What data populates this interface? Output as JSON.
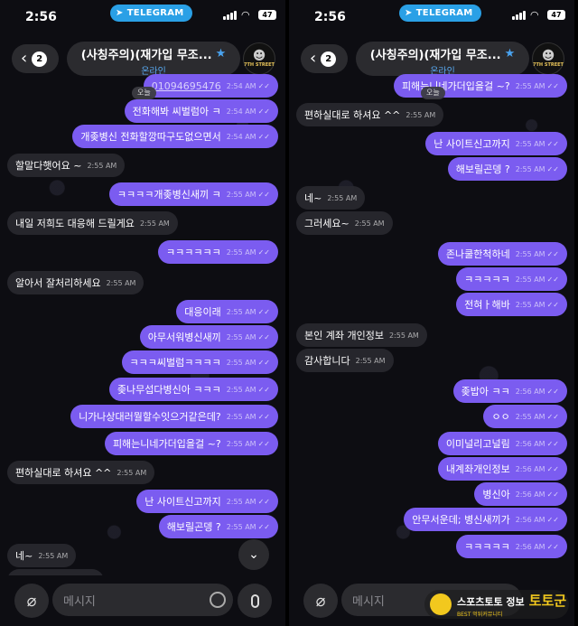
{
  "status": {
    "time": "2:56",
    "app_pill": "TELEGRAM",
    "battery": "47"
  },
  "header": {
    "back_badge": "2",
    "title": "(사칭주의)(재가입 무조...",
    "subtitle": "온라인",
    "avatar_text": "7TH STREET"
  },
  "left_screen": {
    "day_label": "오늘",
    "messages": [
      {
        "text": "01094695476",
        "time": "2:54 AM",
        "out": true,
        "link": true
      },
      {
        "text": "전화해봐 씨벌럼아 ㅋ",
        "time": "2:54 AM",
        "out": true
      },
      {
        "text": "개좆병신 전화할깡따구도없으면서",
        "time": "2:54 AM",
        "out": true
      },
      {
        "text": "할말다햇어요 ~",
        "time": "2:55 AM",
        "out": false
      },
      {
        "text": "ㅋㅋㅋㅋ개좆병신새끼 ㅋ",
        "time": "2:55 AM",
        "out": true
      },
      {
        "text": "내일 저희도 대응해 드릴게요",
        "time": "2:55 AM",
        "out": false
      },
      {
        "text": "ㅋㅋㅋㅋㅋㅋ",
        "time": "2:55 AM",
        "out": true
      },
      {
        "text": "알아서 잘처리하세요",
        "time": "2:55 AM",
        "out": false
      },
      {
        "text": "대응이래",
        "time": "2:55 AM",
        "out": true
      },
      {
        "text": "아무서워병신새끼",
        "time": "2:55 AM",
        "out": true
      },
      {
        "text": "ㅋㅋㅋ씨벌럼ㅋㅋㅋㅋ",
        "time": "2:55 AM",
        "out": true
      },
      {
        "text": "좆나무섭다병신아 ㅋㅋㅋ",
        "time": "2:55 AM",
        "out": true
      },
      {
        "text": "니가나상대러뭘할수잇으거같은데?",
        "time": "2:55 AM",
        "out": true
      },
      {
        "text": "피해는니네가더입을걸 ~?",
        "time": "2:55 AM",
        "out": true
      },
      {
        "text": "편하실대로 하셔요 ^^",
        "time": "2:55 AM",
        "out": false
      },
      {
        "text": "난 사이트신고까지",
        "time": "2:55 AM",
        "out": true
      },
      {
        "text": "해보릴곤뎅 ?",
        "time": "2:55 AM",
        "out": true
      },
      {
        "text": "네~",
        "time": "2:55 AM",
        "out": false
      },
      {
        "text": "그러세요~",
        "time": "2:55 AM",
        "out": false
      }
    ]
  },
  "right_screen": {
    "day_label": "오늘",
    "messages": [
      {
        "text": "피해는니네가더입을걸 ~?",
        "time": "2:55 AM",
        "out": true
      },
      {
        "text": "편하실대로 하셔요 ^^",
        "time": "2:55 AM",
        "out": false
      },
      {
        "text": "난 사이트신고까지",
        "time": "2:55 AM",
        "out": true
      },
      {
        "text": "해보릴곤뎅 ?",
        "time": "2:55 AM",
        "out": true
      },
      {
        "text": "네~",
        "time": "2:55 AM",
        "out": false
      },
      {
        "text": "그러세요~",
        "time": "2:55 AM",
        "out": false
      },
      {
        "text": "존나쿨한척하네",
        "time": "2:55 AM",
        "out": true
      },
      {
        "text": "ㅋㅋㅋㅋㅋ",
        "time": "2:55 AM",
        "out": true
      },
      {
        "text": "전혀ㅏ해바",
        "time": "2:55 AM",
        "out": true
      },
      {
        "text": "본인 계좌 개인정보",
        "time": "2:55 AM",
        "out": false
      },
      {
        "text": "감사합니다",
        "time": "2:55 AM",
        "out": false
      },
      {
        "text": "좆밥아 ㅋㅋ",
        "time": "2:56 AM",
        "out": true
      },
      {
        "text": "ㅇㅇ",
        "time": "2:55 AM",
        "out": true
      },
      {
        "text": "이미널리고널림",
        "time": "2:56 AM",
        "out": true
      },
      {
        "text": "내계좌개인정보",
        "time": "2:56 AM",
        "out": true
      },
      {
        "text": "병신아",
        "time": "2:56 AM",
        "out": true
      },
      {
        "text": "안무서운데; 병신새끼가",
        "time": "2:56 AM",
        "out": true
      },
      {
        "text": "ㅋㅋㅋㅋㅋ",
        "time": "2:56 AM",
        "out": true
      }
    ]
  },
  "input": {
    "placeholder": "메시지"
  },
  "watermark": {
    "main": "스포츠토토 정보",
    "brand": "토토군",
    "sub": "BEST 먹튀커뮤니티"
  },
  "colors": {
    "outgoing": "#7b5cf0",
    "incoming": "#28282e",
    "accent": "#2aa0e6"
  },
  "icons": [
    "telegram-plane-icon",
    "signal-icon",
    "wifi-icon",
    "battery-icon",
    "back-chevron-icon",
    "verified-star-icon",
    "attach-paperclip-icon",
    "sticker-icon",
    "microphone-icon",
    "chevron-down-icon",
    "read-check-icon"
  ]
}
